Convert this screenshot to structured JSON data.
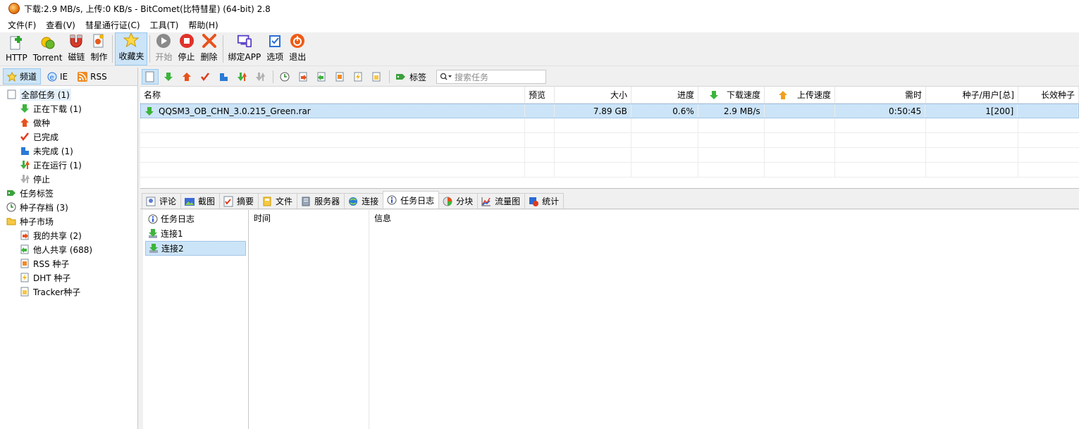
{
  "titlebar": {
    "title": "下载:2.9 MB/s, 上传:0 KB/s - BitComet(比特彗星) (64-bit) 2.8"
  },
  "menu": [
    "文件(F)",
    "查看(V)",
    "彗星通行证(C)",
    "工具(T)",
    "帮助(H)"
  ],
  "toolbar": {
    "http": "HTTP",
    "torrent": "Torrent",
    "magnet": "磁链",
    "make": "制作",
    "favorites": "收藏夹",
    "start": "开始",
    "stop": "停止",
    "delete": "删除",
    "bind_app": "绑定APP",
    "options": "选项",
    "exit": "退出"
  },
  "sidebar": {
    "tabs": {
      "channel": "频道",
      "ie": "IE",
      "rss": "RSS"
    },
    "items": [
      {
        "label": "全部任务 (1)"
      },
      {
        "label": "正在下载 (1)"
      },
      {
        "label": "做种"
      },
      {
        "label": "已完成"
      },
      {
        "label": "未完成 (1)"
      },
      {
        "label": "正在运行 (1)"
      },
      {
        "label": "停止"
      },
      {
        "label": "任务标签"
      },
      {
        "label": "种子存档 (3)"
      },
      {
        "label": "种子市场"
      },
      {
        "label": "我的共享 (2)"
      },
      {
        "label": "他人共享 (688)"
      },
      {
        "label": "RSS 种子"
      },
      {
        "label": "DHT 种子"
      },
      {
        "label": "Tracker种子"
      }
    ]
  },
  "task_toolbar": {
    "tags_label": "标签",
    "search_placeholder": "搜索任务"
  },
  "task_table": {
    "headers": [
      "名称",
      "预览",
      "大小",
      "进度",
      "下载速度",
      "上传速度",
      "需时",
      "种子/用户[总]",
      "长效种子"
    ],
    "rows": [
      {
        "name": "QQSM3_OB_CHN_3.0.215_Green.rar",
        "preview": "",
        "size": "7.89 GB",
        "progress": "0.6%",
        "down_speed": "2.9 MB/s",
        "up_speed": "",
        "eta": "0:50:45",
        "seeds_peers": "1[200]",
        "long_seed": ""
      }
    ]
  },
  "bottom_tabs": [
    "评论",
    "截图",
    "摘要",
    "文件",
    "服务器",
    "连接",
    "任务日志",
    "分块",
    "流量图",
    "统计"
  ],
  "log": {
    "tree": [
      "任务日志",
      "连接1",
      "连接2"
    ],
    "columns": [
      "时间",
      "信息"
    ]
  }
}
